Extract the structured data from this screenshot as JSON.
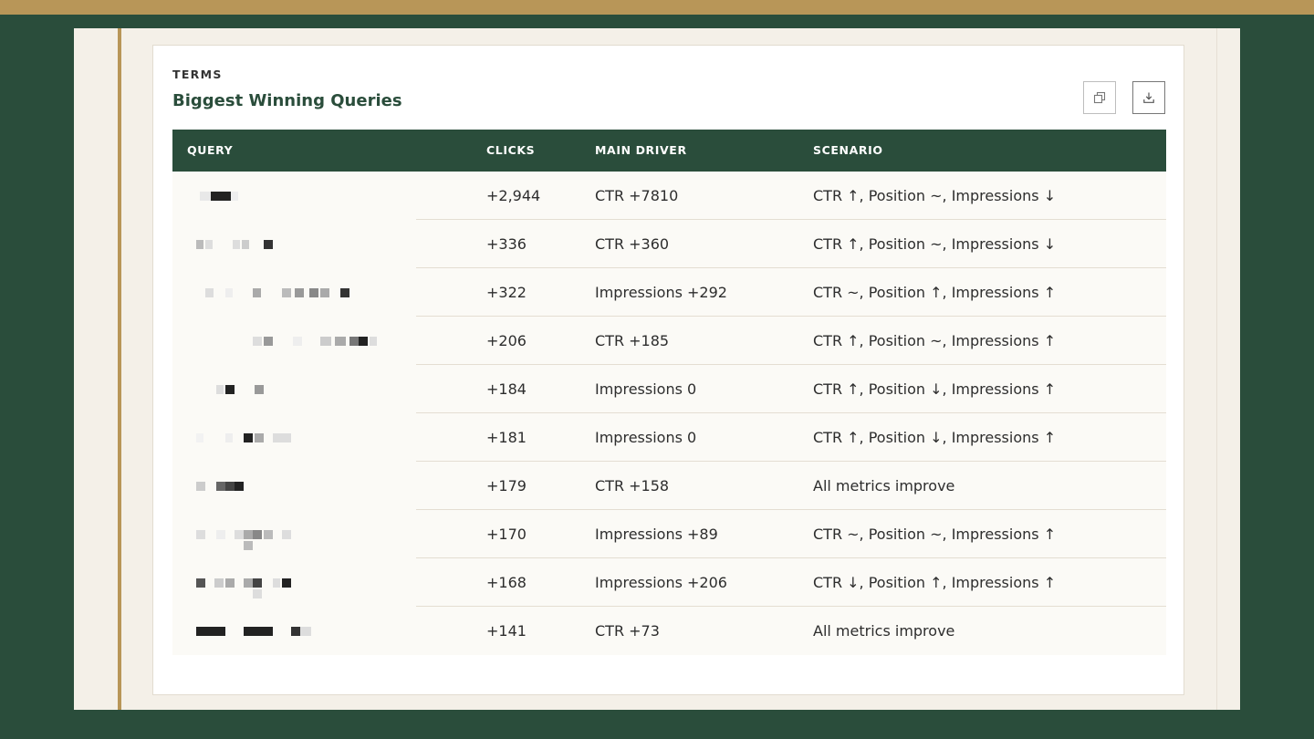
{
  "panel": {
    "eyebrow": "TERMS",
    "title": "Biggest Winning Queries",
    "actions": [
      {
        "icon": "copy-icon"
      },
      {
        "icon": "download-icon"
      }
    ]
  },
  "table": {
    "columns": [
      "QUERY",
      "CLICKS",
      "MAIN DRIVER",
      "SCENARIO"
    ],
    "rows": [
      {
        "query": "",
        "clicks": "+2,944",
        "driver": "CTR +7810",
        "scenario": "CTR ↑, Position ~, Impressions ↓"
      },
      {
        "query": "",
        "clicks": "+336",
        "driver": "CTR +360",
        "scenario": "CTR ↑, Position ~, Impressions ↓"
      },
      {
        "query": "",
        "clicks": "+322",
        "driver": "Impressions +292",
        "scenario": "CTR ~, Position ↑, Impressions ↑"
      },
      {
        "query": "",
        "clicks": "+206",
        "driver": "CTR +185",
        "scenario": "CTR ↑, Position ~, Impressions ↑"
      },
      {
        "query": "",
        "clicks": "+184",
        "driver": "Impressions 0",
        "scenario": "CTR ↑, Position ↓, Impressions ↑"
      },
      {
        "query": "",
        "clicks": "+181",
        "driver": "Impressions 0",
        "scenario": "CTR ↑, Position ↓, Impressions ↑"
      },
      {
        "query": "",
        "clicks": "+179",
        "driver": "CTR +158",
        "scenario": "All metrics improve"
      },
      {
        "query": "",
        "clicks": "+170",
        "driver": "Impressions +89",
        "scenario": "CTR ~, Position ~, Impressions ↑"
      },
      {
        "query": "",
        "clicks": "+168",
        "driver": "Impressions +206",
        "scenario": "CTR ↓, Position ↑, Impressions ↑"
      },
      {
        "query": "",
        "clicks": "+141",
        "driver": "CTR +73",
        "scenario": "All metrics improve"
      }
    ]
  },
  "colors": {
    "brand_green": "#2a4d3b",
    "accent_gold": "#b89658",
    "row_background": "#fbfaf6"
  }
}
